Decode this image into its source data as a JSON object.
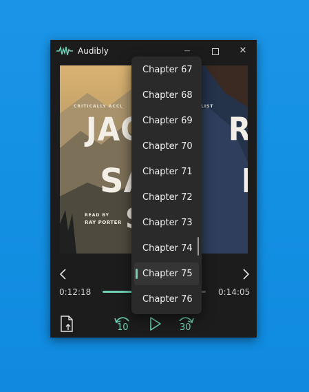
{
  "window": {
    "app_title": "Audibly",
    "minimize_glyph": "—",
    "close_glyph": "✕"
  },
  "cover": {
    "tagline_left": "CRITICALLY ACCL",
    "tagline_right": "LIST",
    "author_text": "JAC        RR",
    "title_text": "SA        E",
    "title_text2": "S",
    "narrator_line1": "READ BY",
    "narrator_line2": "RAY PORTER"
  },
  "player": {
    "elapsed": "0:12:18",
    "total": "0:14:05",
    "progress_fraction": 0.3,
    "skip_back_seconds": "10",
    "skip_forward_seconds": "30",
    "prev_glyph": "‹",
    "next_glyph": "›"
  },
  "chapter_menu": {
    "items": [
      {
        "label": "Chapter 67"
      },
      {
        "label": "Chapter 68"
      },
      {
        "label": "Chapter 69"
      },
      {
        "label": "Chapter 70"
      },
      {
        "label": "Chapter 71"
      },
      {
        "label": "Chapter 72"
      },
      {
        "label": "Chapter 73"
      },
      {
        "label": "Chapter 74"
      },
      {
        "label": "Chapter 75"
      },
      {
        "label": "Chapter 76"
      }
    ],
    "selected_index": 8
  },
  "colors": {
    "accent": "#6fd1b6",
    "window_bg": "#1c1c1c",
    "menu_bg": "#2a2a2a",
    "desktop": "#1591e3"
  },
  "icons": {
    "app": "waveform-icon",
    "file": "file-export-icon",
    "rewind": "rewind-icon",
    "play": "play-icon",
    "forward": "fast-forward-icon"
  }
}
